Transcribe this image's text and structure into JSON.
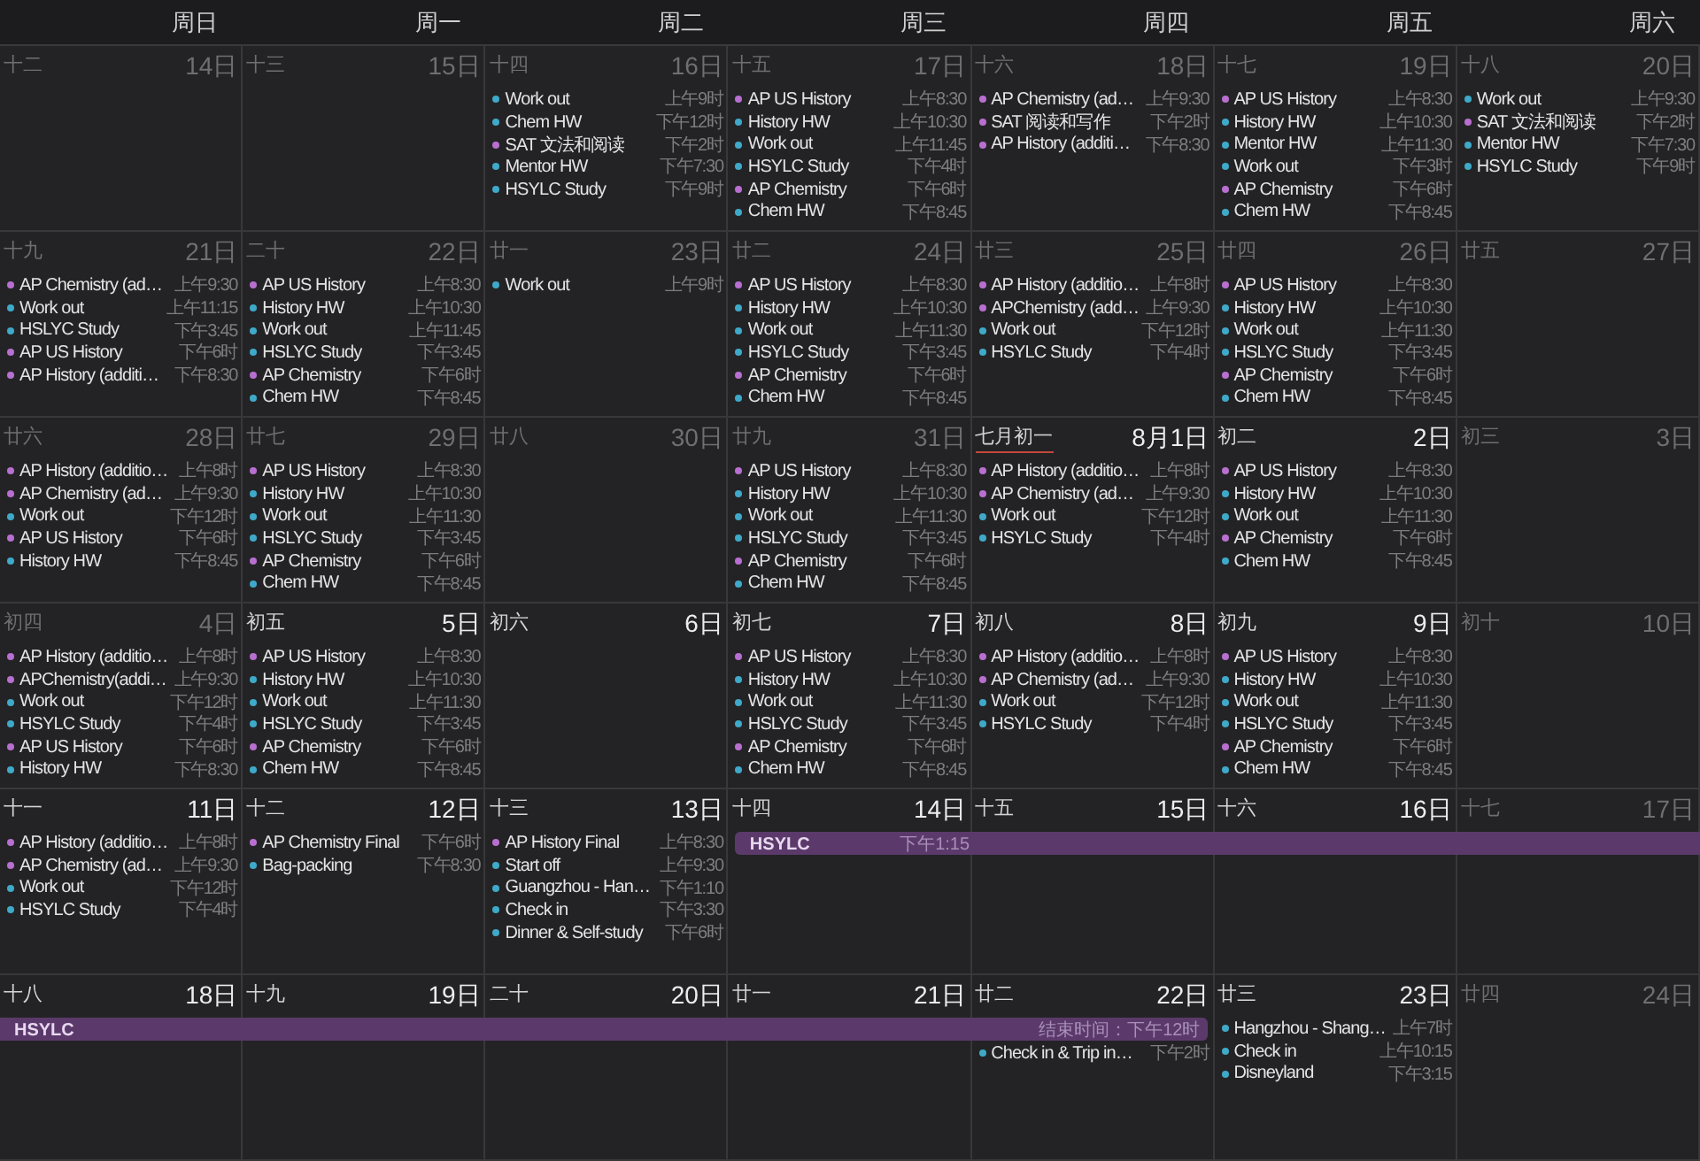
{
  "weekdays": [
    "周日",
    "周一",
    "周二",
    "周三",
    "周四",
    "周五",
    "周六"
  ],
  "weeks": [
    {
      "days": [
        {
          "lunar": "十二",
          "date": "14日",
          "dimmed": true
        },
        {
          "lunar": "十三",
          "date": "15日",
          "dimmed": true
        },
        {
          "lunar": "十四",
          "date": "16日",
          "dimmed": true,
          "events": [
            {
              "title": "Work out",
              "time": "上午9时",
              "color": "#3fa9c9"
            },
            {
              "title": "Chem HW",
              "time": "下午12时",
              "color": "#3fa9c9"
            },
            {
              "title": "SAT 文法和阅读",
              "time": "下午2时",
              "color": "#b86fd0"
            },
            {
              "title": "Mentor HW",
              "time": "下午7:30",
              "color": "#3fa9c9"
            },
            {
              "title": "HSYLC Study",
              "time": "下午9时",
              "color": "#3fa9c9"
            }
          ]
        },
        {
          "lunar": "十五",
          "date": "17日",
          "dimmed": true,
          "events": [
            {
              "title": "AP US History",
              "time": "上午8:30",
              "color": "#b86fd0"
            },
            {
              "title": "History HW",
              "time": "上午10:30",
              "color": "#3fa9c9"
            },
            {
              "title": "Work out",
              "time": "上午11:45",
              "color": "#3fa9c9"
            },
            {
              "title": "HSYLC Study",
              "time": "下午4时",
              "color": "#3fa9c9"
            },
            {
              "title": "AP Chemistry",
              "time": "下午6时",
              "color": "#b86fd0"
            },
            {
              "title": "Chem HW",
              "time": "下午8:45",
              "color": "#3fa9c9"
            }
          ]
        },
        {
          "lunar": "十六",
          "date": "18日",
          "dimmed": true,
          "events": [
            {
              "title": "AP Chemistry (ad…",
              "time": "上午9:30",
              "color": "#b86fd0"
            },
            {
              "title": "SAT 阅读和写作",
              "time": "下午2时",
              "color": "#b86fd0"
            },
            {
              "title": "AP History (additi…",
              "time": "下午8:30",
              "color": "#b86fd0"
            }
          ]
        },
        {
          "lunar": "十七",
          "date": "19日",
          "dimmed": true,
          "events": [
            {
              "title": "AP US History",
              "time": "上午8:30",
              "color": "#b86fd0"
            },
            {
              "title": "History HW",
              "time": "上午10:30",
              "color": "#3fa9c9"
            },
            {
              "title": "Mentor HW",
              "time": "上午11:30",
              "color": "#3fa9c9"
            },
            {
              "title": "Work out",
              "time": "下午3时",
              "color": "#3fa9c9"
            },
            {
              "title": "AP Chemistry",
              "time": "下午6时",
              "color": "#b86fd0"
            },
            {
              "title": "Chem HW",
              "time": "下午8:45",
              "color": "#3fa9c9"
            }
          ]
        },
        {
          "lunar": "十八",
          "date": "20日",
          "dimmed": true,
          "events": [
            {
              "title": "Work out",
              "time": "上午9:30",
              "color": "#3fa9c9"
            },
            {
              "title": "SAT 文法和阅读",
              "time": "下午2时",
              "color": "#b86fd0"
            },
            {
              "title": "Mentor HW",
              "time": "下午7:30",
              "color": "#3fa9c9"
            },
            {
              "title": "HSYLC Study",
              "time": "下午9时",
              "color": "#3fa9c9"
            }
          ]
        }
      ]
    },
    {
      "days": [
        {
          "lunar": "十九",
          "date": "21日",
          "dimmed": true,
          "events": [
            {
              "title": "AP Chemistry (ad…",
              "time": "上午9:30",
              "color": "#b86fd0"
            },
            {
              "title": "Work out",
              "time": "上午11:15",
              "color": "#3fa9c9"
            },
            {
              "title": "HSLYC Study",
              "time": "下午3:45",
              "color": "#3fa9c9"
            },
            {
              "title": "AP US History",
              "time": "下午6时",
              "color": "#b86fd0"
            },
            {
              "title": "AP History (additi…",
              "time": "下午8:30",
              "color": "#b86fd0"
            }
          ]
        },
        {
          "lunar": "二十",
          "date": "22日",
          "dimmed": true,
          "events": [
            {
              "title": "AP US History",
              "time": "上午8:30",
              "color": "#b86fd0"
            },
            {
              "title": "History HW",
              "time": "上午10:30",
              "color": "#3fa9c9"
            },
            {
              "title": "Work out",
              "time": "上午11:45",
              "color": "#3fa9c9"
            },
            {
              "title": "HSLYC Study",
              "time": "下午3:45",
              "color": "#3fa9c9"
            },
            {
              "title": "AP Chemistry",
              "time": "下午6时",
              "color": "#b86fd0"
            },
            {
              "title": "Chem HW",
              "time": "下午8:45",
              "color": "#3fa9c9"
            }
          ]
        },
        {
          "lunar": "廿一",
          "date": "23日",
          "dimmed": true,
          "events": [
            {
              "title": "Work out",
              "time": "上午9时",
              "color": "#3fa9c9"
            }
          ]
        },
        {
          "lunar": "廿二",
          "date": "24日",
          "dimmed": true,
          "events": [
            {
              "title": "AP US History",
              "time": "上午8:30",
              "color": "#b86fd0"
            },
            {
              "title": "History HW",
              "time": "上午10:30",
              "color": "#3fa9c9"
            },
            {
              "title": "Work out",
              "time": "上午11:30",
              "color": "#3fa9c9"
            },
            {
              "title": "HSYLC Study",
              "time": "下午3:45",
              "color": "#3fa9c9"
            },
            {
              "title": "AP Chemistry",
              "time": "下午6时",
              "color": "#b86fd0"
            },
            {
              "title": "Chem HW",
              "time": "下午8:45",
              "color": "#3fa9c9"
            }
          ]
        },
        {
          "lunar": "廿三",
          "date": "25日",
          "dimmed": true,
          "events": [
            {
              "title": "AP History (additio…",
              "time": "上午8时",
              "color": "#b86fd0"
            },
            {
              "title": "APChemistry (add…",
              "time": "上午9:30",
              "color": "#b86fd0"
            },
            {
              "title": "Work out",
              "time": "下午12时",
              "color": "#3fa9c9"
            },
            {
              "title": "HSYLC Study",
              "time": "下午4时",
              "color": "#3fa9c9"
            }
          ]
        },
        {
          "lunar": "廿四",
          "date": "26日",
          "dimmed": true,
          "events": [
            {
              "title": "AP US History",
              "time": "上午8:30",
              "color": "#b86fd0"
            },
            {
              "title": "History HW",
              "time": "上午10:30",
              "color": "#3fa9c9"
            },
            {
              "title": "Work out",
              "time": "上午11:30",
              "color": "#3fa9c9"
            },
            {
              "title": "HSLYC Study",
              "time": "下午3:45",
              "color": "#3fa9c9"
            },
            {
              "title": "AP Chemistry",
              "time": "下午6时",
              "color": "#b86fd0"
            },
            {
              "title": "Chem HW",
              "time": "下午8:45",
              "color": "#3fa9c9"
            }
          ]
        },
        {
          "lunar": "廿五",
          "date": "27日",
          "dimmed": true
        }
      ]
    },
    {
      "days": [
        {
          "lunar": "廿六",
          "date": "28日",
          "dimmed": true,
          "events": [
            {
              "title": "AP History (additio…",
              "time": "上午8时",
              "color": "#b86fd0"
            },
            {
              "title": "AP Chemistry (ad…",
              "time": "上午9:30",
              "color": "#b86fd0"
            },
            {
              "title": "Work out",
              "time": "下午12时",
              "color": "#3fa9c9"
            },
            {
              "title": "AP US History",
              "time": "下午6时",
              "color": "#b86fd0"
            },
            {
              "title": "History HW",
              "time": "下午8:45",
              "color": "#3fa9c9"
            }
          ]
        },
        {
          "lunar": "廿七",
          "date": "29日",
          "dimmed": true,
          "events": [
            {
              "title": "AP US History",
              "time": "上午8:30",
              "color": "#b86fd0"
            },
            {
              "title": "History HW",
              "time": "上午10:30",
              "color": "#3fa9c9"
            },
            {
              "title": "Work out",
              "time": "上午11:30",
              "color": "#3fa9c9"
            },
            {
              "title": "HSLYC Study",
              "time": "下午3:45",
              "color": "#3fa9c9"
            },
            {
              "title": "AP Chemistry",
              "time": "下午6时",
              "color": "#b86fd0"
            },
            {
              "title": "Chem HW",
              "time": "下午8:45",
              "color": "#3fa9c9"
            }
          ]
        },
        {
          "lunar": "廿八",
          "date": "30日",
          "dimmed": true
        },
        {
          "lunar": "廿九",
          "date": "31日",
          "dimmed": true,
          "events": [
            {
              "title": "AP US History",
              "time": "上午8:30",
              "color": "#b86fd0"
            },
            {
              "title": "History HW",
              "time": "上午10:30",
              "color": "#3fa9c9"
            },
            {
              "title": "Work out",
              "time": "上午11:30",
              "color": "#3fa9c9"
            },
            {
              "title": "HSLYC Study",
              "time": "下午3:45",
              "color": "#3fa9c9"
            },
            {
              "title": "AP Chemistry",
              "time": "下午6时",
              "color": "#b86fd0"
            },
            {
              "title": "Chem HW",
              "time": "下午8:45",
              "color": "#3fa9c9"
            }
          ]
        },
        {
          "lunar": "七月初一",
          "date": "8月1日",
          "dimmed": false,
          "underlined": true,
          "events": [
            {
              "title": "AP History (additio…",
              "time": "上午8时",
              "color": "#b86fd0"
            },
            {
              "title": "AP Chemistry (ad…",
              "time": "上午9:30",
              "color": "#b86fd0"
            },
            {
              "title": "Work out",
              "time": "下午12时",
              "color": "#3fa9c9"
            },
            {
              "title": "HSYLC Study",
              "time": "下午4时",
              "color": "#3fa9c9"
            }
          ]
        },
        {
          "lunar": "初二",
          "date": "2日",
          "dimmed": false,
          "events": [
            {
              "title": "AP US History",
              "time": "上午8:30",
              "color": "#b86fd0"
            },
            {
              "title": "History HW",
              "time": "上午10:30",
              "color": "#3fa9c9"
            },
            {
              "title": "Work out",
              "time": "上午11:30",
              "color": "#3fa9c9"
            },
            {
              "title": "AP Chemistry",
              "time": "下午6时",
              "color": "#b86fd0"
            },
            {
              "title": "Chem HW",
              "time": "下午8:45",
              "color": "#3fa9c9"
            }
          ]
        },
        {
          "lunar": "初三",
          "date": "3日",
          "dimmed": true
        }
      ]
    },
    {
      "days": [
        {
          "lunar": "初四",
          "date": "4日",
          "dimmed": true,
          "events": [
            {
              "title": "AP History (additio…",
              "time": "上午8时",
              "color": "#b86fd0"
            },
            {
              "title": "APChemistry(addi…",
              "time": "上午9:30",
              "color": "#b86fd0"
            },
            {
              "title": "Work out",
              "time": "下午12时",
              "color": "#3fa9c9"
            },
            {
              "title": "HSYLC Study",
              "time": "下午4时",
              "color": "#3fa9c9"
            },
            {
              "title": "AP US History",
              "time": "下午6时",
              "color": "#b86fd0"
            },
            {
              "title": "History HW",
              "time": "下午8:30",
              "color": "#3fa9c9"
            }
          ]
        },
        {
          "lunar": "初五",
          "date": "5日",
          "dimmed": false,
          "events": [
            {
              "title": "AP US History",
              "time": "上午8:30",
              "color": "#b86fd0"
            },
            {
              "title": "History HW",
              "time": "上午10:30",
              "color": "#3fa9c9"
            },
            {
              "title": "Work out",
              "time": "上午11:30",
              "color": "#3fa9c9"
            },
            {
              "title": "HSLYC Study",
              "time": "下午3:45",
              "color": "#3fa9c9"
            },
            {
              "title": "AP Chemistry",
              "time": "下午6时",
              "color": "#b86fd0"
            },
            {
              "title": "Chem HW",
              "time": "下午8:45",
              "color": "#3fa9c9"
            }
          ]
        },
        {
          "lunar": "初六",
          "date": "6日",
          "dimmed": false
        },
        {
          "lunar": "初七",
          "date": "7日",
          "dimmed": false,
          "events": [
            {
              "title": "AP US History",
              "time": "上午8:30",
              "color": "#b86fd0"
            },
            {
              "title": "History HW",
              "time": "上午10:30",
              "color": "#3fa9c9"
            },
            {
              "title": "Work out",
              "time": "上午11:30",
              "color": "#3fa9c9"
            },
            {
              "title": "HSLYC Study",
              "time": "下午3:45",
              "color": "#3fa9c9"
            },
            {
              "title": "AP Chemistry",
              "time": "下午6时",
              "color": "#b86fd0"
            },
            {
              "title": "Chem HW",
              "time": "下午8:45",
              "color": "#3fa9c9"
            }
          ]
        },
        {
          "lunar": "初八",
          "date": "8日",
          "dimmed": false,
          "events": [
            {
              "title": "AP History (additio…",
              "time": "上午8时",
              "color": "#b86fd0"
            },
            {
              "title": "AP Chemistry (ad…",
              "time": "上午9:30",
              "color": "#b86fd0"
            },
            {
              "title": "Work out",
              "time": "下午12时",
              "color": "#3fa9c9"
            },
            {
              "title": "HSYLC Study",
              "time": "下午4时",
              "color": "#3fa9c9"
            }
          ]
        },
        {
          "lunar": "初九",
          "date": "9日",
          "dimmed": false,
          "events": [
            {
              "title": "AP US History",
              "time": "上午8:30",
              "color": "#b86fd0"
            },
            {
              "title": "History HW",
              "time": "上午10:30",
              "color": "#3fa9c9"
            },
            {
              "title": "Work out",
              "time": "上午11:30",
              "color": "#3fa9c9"
            },
            {
              "title": "HSLYC Study",
              "time": "下午3:45",
              "color": "#3fa9c9"
            },
            {
              "title": "AP Chemistry",
              "time": "下午6时",
              "color": "#b86fd0"
            },
            {
              "title": "Chem HW",
              "time": "下午8:45",
              "color": "#3fa9c9"
            }
          ]
        },
        {
          "lunar": "初十",
          "date": "10日",
          "dimmed": true
        }
      ]
    },
    {
      "days": [
        {
          "lunar": "十一",
          "date": "11日",
          "dimmed": false,
          "events": [
            {
              "title": "AP History (additio…",
              "time": "上午8时",
              "color": "#b86fd0"
            },
            {
              "title": "AP Chemistry (ad…",
              "time": "上午9:30",
              "color": "#b86fd0"
            },
            {
              "title": "Work out",
              "time": "下午12时",
              "color": "#3fa9c9"
            },
            {
              "title": "HSYLC Study",
              "time": "下午4时",
              "color": "#3fa9c9"
            }
          ]
        },
        {
          "lunar": "十二",
          "date": "12日",
          "dimmed": false,
          "events": [
            {
              "title": "AP Chemistry  Final",
              "time": "下午6时",
              "color": "#b86fd0"
            },
            {
              "title": "Bag-packing",
              "time": "下午8:30",
              "color": "#3fa9c9"
            }
          ]
        },
        {
          "lunar": "十三",
          "date": "13日",
          "dimmed": false,
          "events": [
            {
              "title": "AP History Final",
              "time": "上午8:30",
              "color": "#b86fd0"
            },
            {
              "title": "Start off",
              "time": "上午9:30",
              "color": "#3fa9c9"
            },
            {
              "title": "Guangzhou - Han…",
              "time": "下午1:10",
              "color": "#3fa9c9"
            },
            {
              "title": "Check in",
              "time": "下午3:30",
              "color": "#3fa9c9"
            },
            {
              "title": "Dinner & Self-study",
              "time": "下午6时",
              "color": "#3fa9c9"
            }
          ]
        },
        {
          "lunar": "十四",
          "date": "14日",
          "dimmed": false,
          "span": true,
          "span_title": "HSYLC",
          "span_time": "下午1:15"
        },
        {
          "lunar": "十五",
          "date": "15日",
          "dimmed": false,
          "span": true
        },
        {
          "lunar": "十六",
          "date": "16日",
          "dimmed": false,
          "span": true
        },
        {
          "lunar": "十七",
          "date": "17日",
          "dimmed": true,
          "span": true
        }
      ]
    },
    {
      "days": [
        {
          "lunar": "十八",
          "date": "18日",
          "dimmed": false,
          "span": true,
          "span_title": "HSYLC"
        },
        {
          "lunar": "十九",
          "date": "19日",
          "dimmed": false,
          "span": true
        },
        {
          "lunar": "二十",
          "date": "20日",
          "dimmed": false,
          "span": true
        },
        {
          "lunar": "廿一",
          "date": "21日",
          "dimmed": false,
          "span": true
        },
        {
          "lunar": "廿二",
          "date": "22日",
          "dimmed": false,
          "span": true,
          "span_time": "结束时间：下午12时",
          "events": [
            {
              "title": "Check in & Trip in…",
              "time": "下午2时",
              "color": "#3fa9c9"
            }
          ]
        },
        {
          "lunar": "廿三",
          "date": "23日",
          "dimmed": false,
          "events": [
            {
              "title": "Hangzhou - Shang…",
              "time": "上午7时",
              "color": "#3fa9c9"
            },
            {
              "title": "Check in",
              "time": "上午10:15",
              "color": "#3fa9c9"
            },
            {
              "title": "Disneyland",
              "time": "下午3:15",
              "color": "#3fa9c9"
            }
          ]
        },
        {
          "lunar": "廿四",
          "date": "24日",
          "dimmed": true
        }
      ]
    }
  ]
}
